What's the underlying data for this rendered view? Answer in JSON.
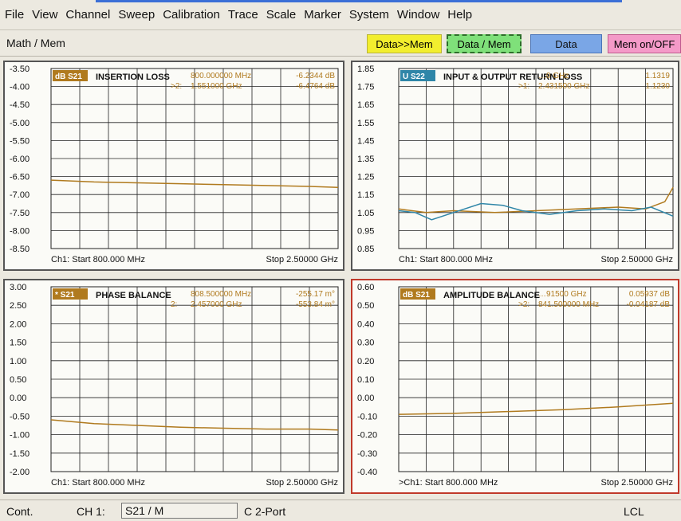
{
  "menubar": {
    "items": [
      "File",
      "View",
      "Channel",
      "Sweep",
      "Calibration",
      "Trace",
      "Scale",
      "Marker",
      "System",
      "Window",
      "Help"
    ]
  },
  "softkeys": {
    "mode_label": "Math / Mem",
    "data_to_mem": "Data>>Mem",
    "data_div_mem": "Data / Mem",
    "data": "Data",
    "mem_on_off": "Mem on/OFF"
  },
  "colors": {
    "trace_primary": "#b07a1e",
    "trace_secondary": "#2f86a8",
    "grid": "#222222",
    "active_border": "#c0392b"
  },
  "panels": [
    {
      "id": "insertion-loss",
      "trace_badge": "dB S21",
      "title": "INSERTION LOSS",
      "y_ticks": [
        "-3.50",
        "-4.00",
        "-4.50",
        "-5.00",
        "-5.50",
        "-6.00",
        "-6.50",
        "-7.00",
        "-7.50",
        "-8.00",
        "-8.50"
      ],
      "markers": [
        {
          "label": "",
          "freq": "800.000000 MHz",
          "value": "-6.2344 dB"
        },
        {
          "label": ">2:",
          "freq": "1.551000 GHz",
          "value": "-6.4764 dB"
        }
      ],
      "footer_start": "Ch1: Start  800.000 MHz",
      "footer_stop": "Stop  2.50000 GHz",
      "active": false
    },
    {
      "id": "return-loss",
      "trace_badge": "U S22",
      "title": "INPUT & OUTPUT RETURN LOSS",
      "y_ticks": [
        "1.85",
        "1.75",
        "1.65",
        "1.55",
        "1.45",
        "1.35",
        "1.25",
        "1.15",
        "1.05",
        "0.95",
        "0.85"
      ],
      "markers": [
        {
          "label": "",
          "freq": "…0 GHz",
          "value": "1.1319"
        },
        {
          "label": ">1:",
          "freq": "2.431500 GHz",
          "value": "1.1230"
        }
      ],
      "footer_start": "Ch1: Start  800.000 MHz",
      "footer_stop": "Stop  2.50000 GHz",
      "active": false
    },
    {
      "id": "phase-balance",
      "trace_badge": "* S21",
      "title": "PHASE BALANCE",
      "y_ticks": [
        "3.00",
        "2.50",
        "2.00",
        "1.50",
        "1.00",
        "0.50",
        "0.00",
        "-0.50",
        "-1.00",
        "-1.50",
        "-2.00"
      ],
      "markers": [
        {
          "label": "",
          "freq": "808.500000 MHz",
          "value": "-255.17 m°"
        },
        {
          "label": "2:",
          "freq": "2.457000 GHz",
          "value": "-553.84 m°"
        }
      ],
      "footer_start": "Ch1: Start  800.000 MHz",
      "footer_stop": "Stop  2.50000 GHz",
      "active": false
    },
    {
      "id": "amplitude-balance",
      "trace_badge": "dB S21",
      "title": "AMPLITUDE BALANCE",
      "y_ticks": [
        "0.60",
        "0.50",
        "0.40",
        "0.30",
        "0.20",
        "0.10",
        "0.00",
        "-0.10",
        "-0.20",
        "-0.30",
        "-0.40"
      ],
      "markers": [
        {
          "label": "",
          "freq": "…91500 GHz",
          "value": "0.05937 dB"
        },
        {
          "label": ">2:",
          "freq": "841.500000 MHz",
          "value": "-0.04187 dB"
        }
      ],
      "footer_start": ">Ch1: Start  800.000 MHz",
      "footer_stop": "Stop  2.50000 GHz",
      "active": true
    }
  ],
  "statusbar": {
    "mode": "Cont.",
    "channel": "CH 1:",
    "measurement": "S21 / M",
    "port_mode": "C  2-Port",
    "remote": "LCL"
  }
}
